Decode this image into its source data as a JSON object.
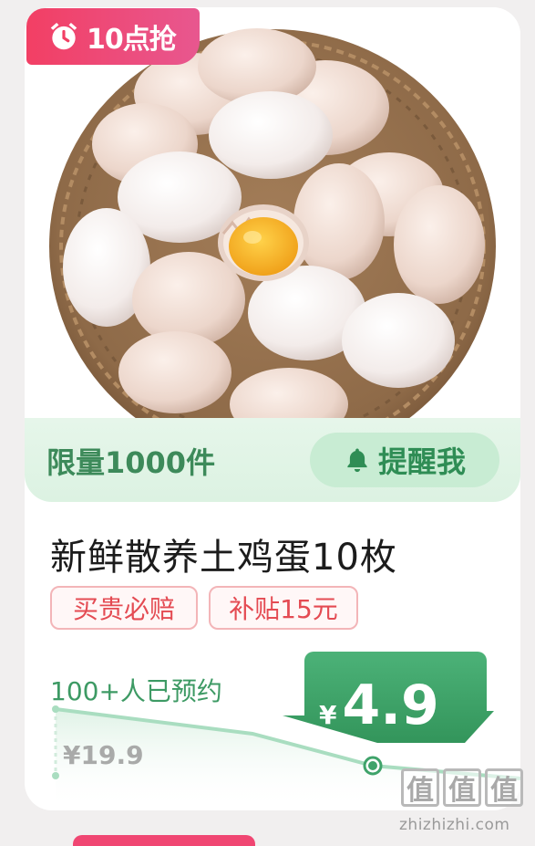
{
  "badge": {
    "label": "10点抢",
    "icon": "alarm-clock-icon",
    "color_start": "#f23f64",
    "color_end": "#e8578f"
  },
  "product": {
    "image_alt": "eggs-basket",
    "limit_text": "限量1000件",
    "remind_label": "提醒我",
    "title": "新鲜散养土鸡蛋10枚",
    "tags": [
      "买贵必赔",
      "补贴15元"
    ]
  },
  "pricing": {
    "reserved_text": "100+人已预约",
    "currency": "¥",
    "price": "4.9",
    "original_price": "¥19.9"
  },
  "watermark": {
    "chars": [
      "值",
      "值",
      "值"
    ],
    "url": "zhizhizhi.com"
  },
  "colors": {
    "accent_green": "#3d9a64",
    "tag_red": "#e44b53",
    "price_green": "#3fa36a"
  }
}
